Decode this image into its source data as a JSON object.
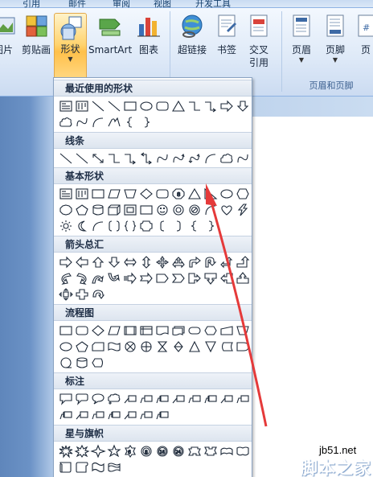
{
  "tabs": [
    "引用",
    "邮件",
    "审阅",
    "视图",
    "开发工具"
  ],
  "ribbon": {
    "picture_label": "图片",
    "clipart_label": "剪贴画",
    "shapes_label": "形状",
    "smartart_label": "SmartArt",
    "chart_label": "图表",
    "hyperlink_label": "超链接",
    "bookmark_label": "书签",
    "crossref_label_1": "交叉",
    "crossref_label_2": "引用",
    "header_label": "页眉",
    "footer_label": "页脚",
    "pagenum_label": "页",
    "group_header_footer": "页眉和页脚"
  },
  "dropdown": {
    "categories": [
      "最近使用的形状",
      "线条",
      "基本形状",
      "箭头总汇",
      "流程图",
      "标注",
      "星与旗帜"
    ]
  },
  "watermark": {
    "site": "jb51.net",
    "name": "脚本之家"
  },
  "colors": {
    "accent": "#ffc04a",
    "annotation": "#e53a3a",
    "ribbon": "#dfeaf8"
  }
}
